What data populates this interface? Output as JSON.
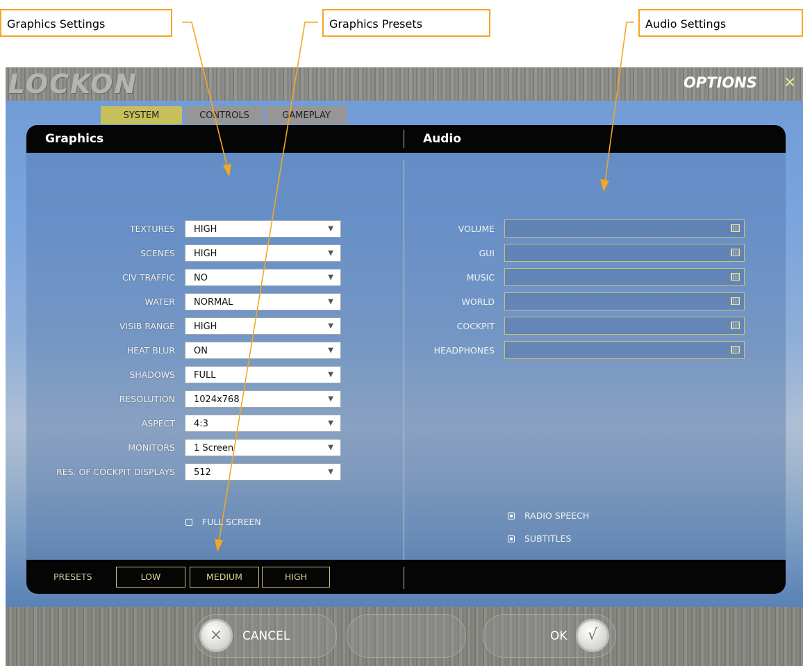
{
  "callouts": {
    "graphics_settings": "Graphics Settings",
    "graphics_presets": "Graphics Presets",
    "audio_settings": "Audio Settings"
  },
  "app": {
    "logo": "LOCKON",
    "title": "OPTIONS",
    "close_glyph": "×"
  },
  "tabs": [
    {
      "label": "SYSTEM",
      "active": true
    },
    {
      "label": "CONTROLS",
      "active": false
    },
    {
      "label": "GAMEPLAY",
      "active": false
    }
  ],
  "graphics": {
    "title": "Graphics",
    "settings": [
      {
        "label": "TEXTURES",
        "value": "HIGH"
      },
      {
        "label": "SCENES",
        "value": "HIGH"
      },
      {
        "label": "CIV TRAFFIC",
        "value": "NO"
      },
      {
        "label": "WATER",
        "value": "NORMAL"
      },
      {
        "label": "VISIB RANGE",
        "value": "HIGH"
      },
      {
        "label": "HEAT BLUR",
        "value": "ON"
      },
      {
        "label": "SHADOWS",
        "value": "FULL"
      },
      {
        "label": "RESOLUTION",
        "value": "1024x768"
      },
      {
        "label": "ASPECT",
        "value": "4:3"
      },
      {
        "label": "MONITORS",
        "value": "1 Screen"
      },
      {
        "label": "RES. OF COCKPIT DISPLAYS",
        "value": "512"
      }
    ],
    "full_screen": {
      "label": "FULL SCREEN",
      "checked": false
    }
  },
  "audio": {
    "title": "Audio",
    "sliders": [
      {
        "label": "VOLUME"
      },
      {
        "label": "GUI"
      },
      {
        "label": "MUSIC"
      },
      {
        "label": "WORLD"
      },
      {
        "label": "COCKPIT"
      },
      {
        "label": "HEADPHONES"
      }
    ],
    "radio_speech": {
      "label": "RADIO SPEECH",
      "checked": true
    },
    "subtitles": {
      "label": "SUBTITLES",
      "checked": true
    }
  },
  "presets": {
    "label": "PRESETS",
    "buttons": [
      "LOW",
      "MEDIUM",
      "HIGH"
    ]
  },
  "footer": {
    "cancel_label": "CANCEL",
    "ok_label": "OK",
    "cancel_icon": "×",
    "ok_icon": "√"
  },
  "colors": {
    "callout_border": "#f5a623",
    "active_tab": "#c7c05a",
    "inactive_tab": "#969696",
    "accent_yellow": "#dcd690"
  }
}
